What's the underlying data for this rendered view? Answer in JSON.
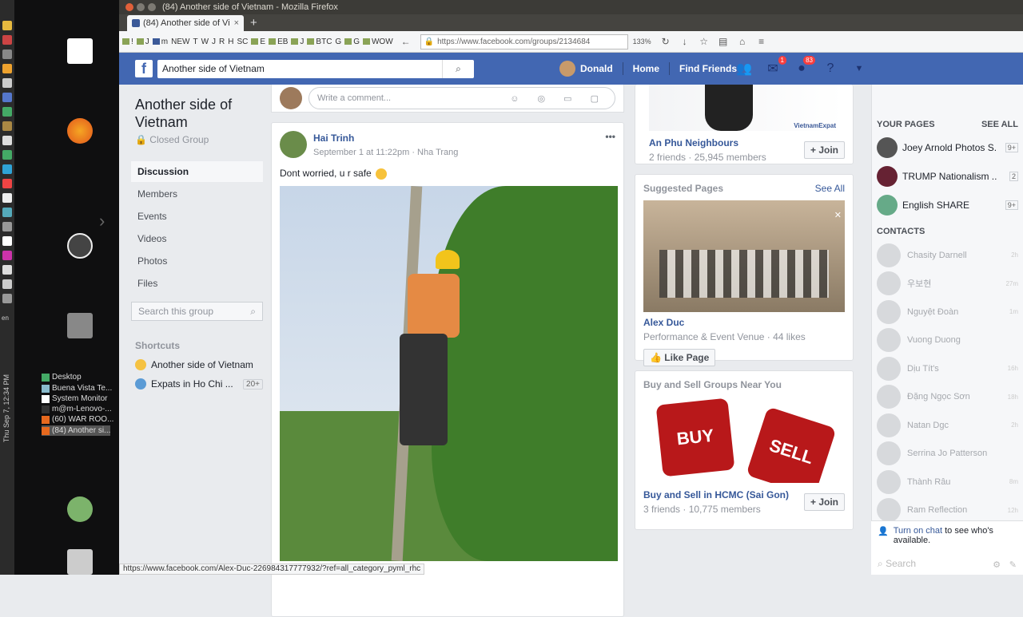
{
  "window": {
    "title": "(84) Another side of Vietnam - Mozilla Firefox"
  },
  "tab": {
    "label": "(84) Another side of Vi"
  },
  "bookmarks": [
    "!",
    "J",
    "m",
    "NEW",
    "T",
    "W",
    "J",
    "R",
    "H",
    "SC",
    "E",
    "EB",
    "J",
    "BTC",
    "G",
    "G",
    "WOW"
  ],
  "url": {
    "value": "https://www.facebook.com/groups/2134684",
    "zoom": "133%"
  },
  "desktop": {
    "taskitems": [
      "Desktop",
      "Buena Vista Te...",
      "System Monitor",
      "m@m-Lenovo-...",
      "(60) WAR ROO...",
      "(84) Another si..."
    ],
    "lang": "en",
    "clock": "Thu Sep 7, 12:34 PM"
  },
  "fb": {
    "logo": "f",
    "search_value": "Another side of Vietnam",
    "user": "Donald",
    "home": "Home",
    "find_friends": "Find Friends",
    "msg_badge": "1",
    "notif_badge": "83"
  },
  "group": {
    "title": "Another side of Vietnam",
    "privacy": "Closed Group",
    "nav": [
      "Discussion",
      "Members",
      "Events",
      "Videos",
      "Photos",
      "Files"
    ],
    "search_placeholder": "Search this group",
    "shortcuts_header": "Shortcuts",
    "shortcuts": [
      {
        "label": "Another side of Vietnam",
        "count": ""
      },
      {
        "label": "Expats in Ho Chi ...",
        "count": "20+"
      }
    ]
  },
  "feed": {
    "comment_placeholder": "Write a comment...",
    "post": {
      "author": "Hai Trinh",
      "meta": "September 1 at 11:22pm · Nha Trang",
      "text": "Dont worried, u r safe"
    }
  },
  "right": {
    "top_group": {
      "image_text": "VietnamExpat",
      "name": "An Phu Neighbours",
      "meta": "2 friends · 25,945 members",
      "join": "Join"
    },
    "suggested": {
      "header": "Suggested Pages",
      "see_all": "See All",
      "name": "Alex Duc",
      "meta": "Performance & Event Venue · 44 likes",
      "like": "Like Page"
    },
    "buysell": {
      "header": "Buy and Sell Groups Near You",
      "dice1": "BUY",
      "dice2": "SELL",
      "name": "Buy and Sell in HCMC (Sai Gon)",
      "meta": "3 friends · 10,775 members",
      "join": "Join"
    }
  },
  "chat": {
    "pages_header": "YOUR PAGES",
    "see_all": "SEE ALL",
    "pages": [
      {
        "name": "Joey Arnold Photos S...",
        "count": "9+"
      },
      {
        "name": "TRUMP Nationalism ...",
        "count": "2"
      },
      {
        "name": "English SHARE",
        "count": "9+"
      }
    ],
    "contacts_header": "CONTACTS",
    "contacts": [
      {
        "name": "Chasity Darnell",
        "time": "2h"
      },
      {
        "name": "우보현",
        "time": "27m"
      },
      {
        "name": "Nguyệt Đoàn",
        "time": "1m"
      },
      {
        "name": "Vuong Duong",
        "time": ""
      },
      {
        "name": "Dịu Tít's",
        "time": "16h"
      },
      {
        "name": "Đặng Ngọc Sơn",
        "time": "18h"
      },
      {
        "name": "Natan Dgc",
        "time": "2h"
      },
      {
        "name": "Serrina Jo Patterson",
        "time": ""
      },
      {
        "name": "Thành Râu",
        "time": "8m"
      },
      {
        "name": "Ram Reflection",
        "time": "12h"
      }
    ],
    "turn_on": "Turn on chat",
    "turn_on_rest": " to see who's available.",
    "search_placeholder": "Search"
  },
  "statusbar": "https://www.facebook.com/Alex-Duc-226984317777932/?ref=all_category_pyml_rhc"
}
